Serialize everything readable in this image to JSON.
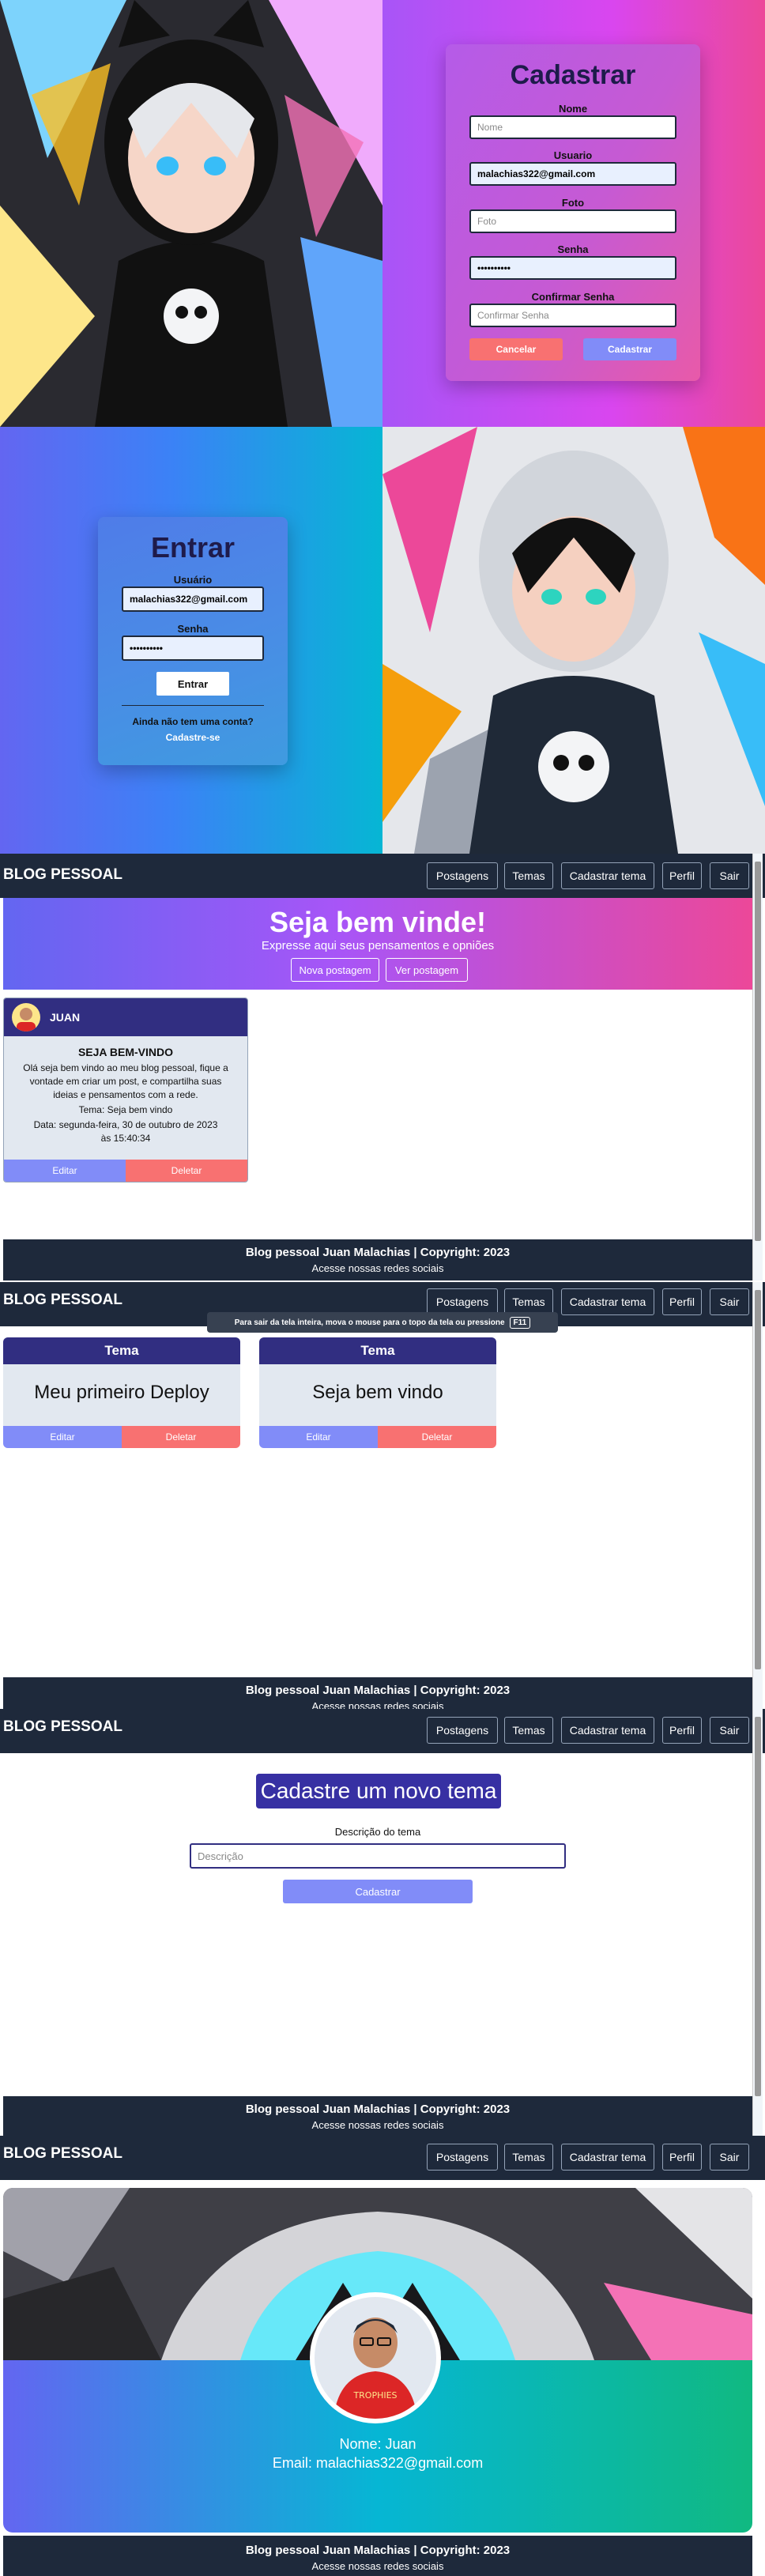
{
  "register": {
    "title": "Cadastrar",
    "name_label": "Nome",
    "name_placeholder": "Nome",
    "user_label": "Usuario",
    "user_value": "malachias322@gmail.com",
    "photo_label": "Foto",
    "photo_placeholder": "Foto",
    "password_label": "Senha",
    "password_value": "••••••••••",
    "confirm_label": "Confirmar Senha",
    "confirm_placeholder": "Confirmar Senha",
    "cancel_label": "Cancelar",
    "submit_label": "Cadastrar"
  },
  "login": {
    "title": "Entrar",
    "user_label": "Usuário",
    "user_value": "malachias322@gmail.com",
    "password_label": "Senha",
    "password_value": "••••••••••",
    "submit_label": "Entrar",
    "no_account": "Ainda não tem uma conta?",
    "signup_link": "Cadastre-se"
  },
  "nav": {
    "brand": "BLOG PESSOAL",
    "items": [
      "Postagens",
      "Temas",
      "Cadastrar tema",
      "Perfil",
      "Sair"
    ]
  },
  "home": {
    "welcome": "Seja bem vinde!",
    "subtitle": "Expresse aqui seus pensamentos e opniões",
    "new_post": "Nova postagem",
    "view_posts": "Ver postagem"
  },
  "post": {
    "author": "JUAN",
    "title": "SEJA BEM-VINDO",
    "body": "Olá seja bem vindo ao meu blog pessoal, fique a vontade em criar um post, e compartilha suas ideias e pensamentos com a rede.",
    "theme": "Tema: Seja bem vindo",
    "date": "Data: segunda-feira, 30 de outubro de 2023 às 15:40:34",
    "edit": "Editar",
    "delete": "Deletar"
  },
  "footer": {
    "copyright": "Blog pessoal Juan Malachias | Copyright: 2023",
    "social": "Acesse nossas redes sociais"
  },
  "fullscreen_notice": {
    "text": "Para sair da tela inteira, mova o mouse para o topo da tela ou pressione",
    "key": "F11"
  },
  "themes": {
    "header": "Tema",
    "items": [
      {
        "description": "Meu primeiro Deploy"
      },
      {
        "description": "Seja bem vindo"
      }
    ],
    "edit": "Editar",
    "delete": "Deletar"
  },
  "new_theme": {
    "title": "Cadastre um novo tema",
    "label": "Descrição do tema",
    "placeholder": "Descrição",
    "submit": "Cadastrar"
  },
  "profile": {
    "name": "Nome: Juan",
    "email": "Email: malachias322@gmail.com",
    "avatar_badge": "TROPHIES"
  },
  "colors": {
    "navy": "#1e293b",
    "indigo": "#312e81",
    "accent_indigo": "#818cf8",
    "accent_red": "#f87171",
    "pink": "#ec4899",
    "purple": "#a855f7"
  }
}
